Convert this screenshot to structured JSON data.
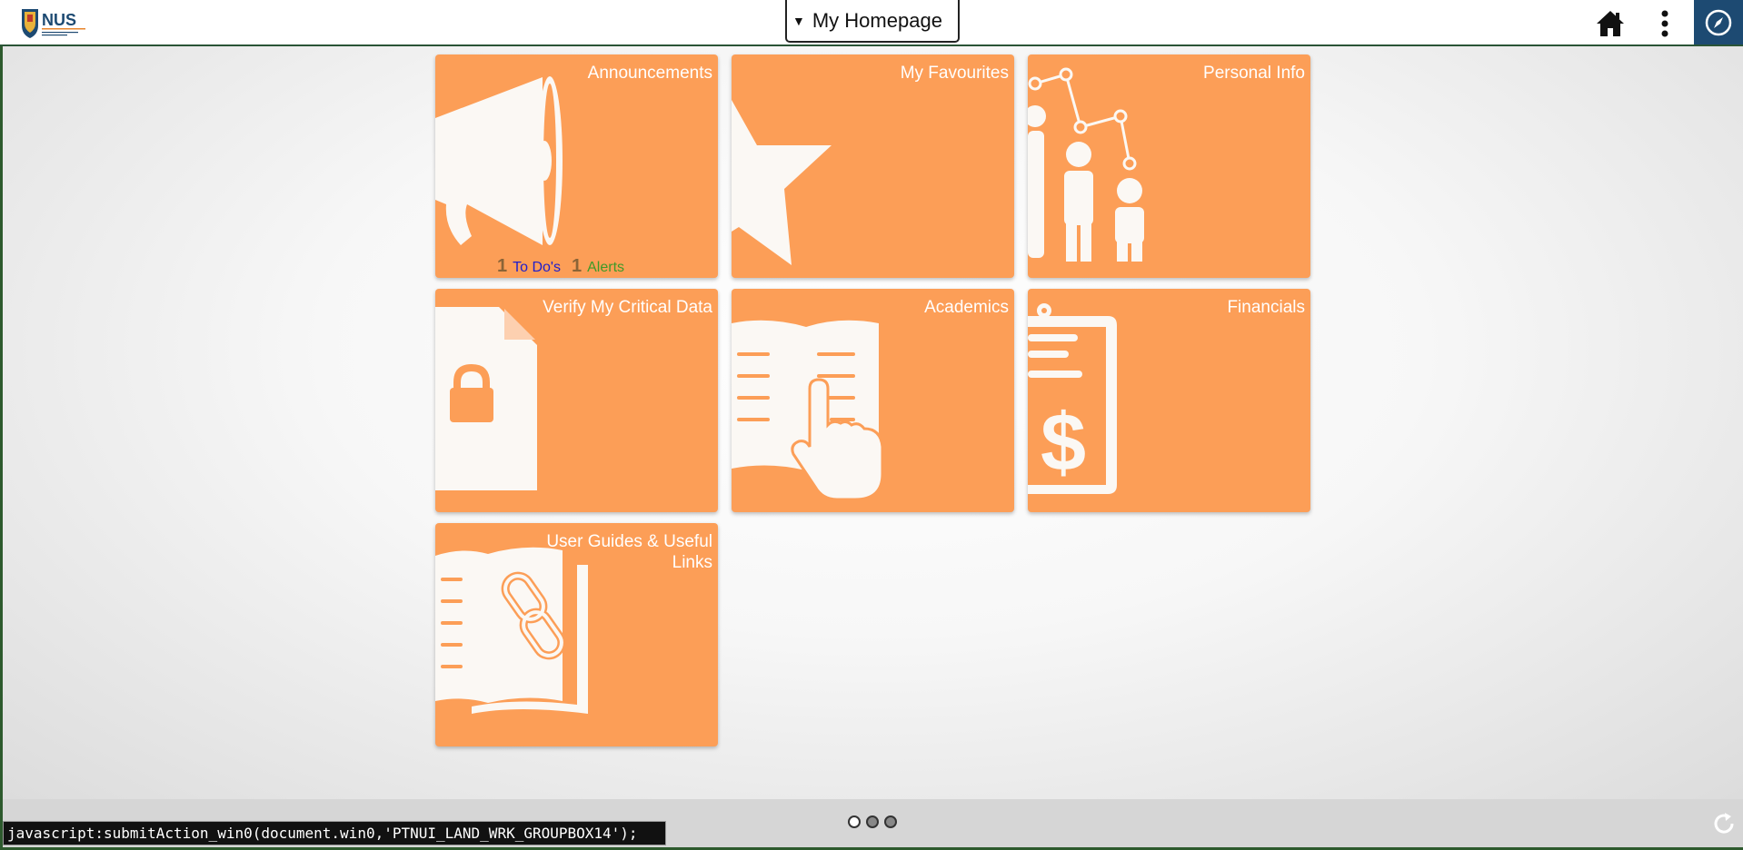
{
  "header": {
    "logo_text": "NUS",
    "logo_subtext": "National University of Singapore",
    "homepage_selector": "My Homepage",
    "home_icon": "home-icon",
    "menu_icon": "kebab-menu-icon",
    "navbar_icon": "compass-icon"
  },
  "tiles": [
    {
      "title": "Announcements",
      "icon": "megaphone-icon"
    },
    {
      "title": "My Favourites",
      "icon": "star-icon"
    },
    {
      "title": "Personal Info",
      "icon": "people-chart-icon"
    },
    {
      "title": "Verify My Critical Data",
      "icon": "locked-document-icon"
    },
    {
      "title": "Academics",
      "icon": "book-pointer-icon"
    },
    {
      "title": "Financials",
      "icon": "clipboard-dollar-icon"
    },
    {
      "title": "User Guides & Useful Links",
      "icon": "book-link-icon"
    }
  ],
  "announcements_counts": {
    "todo_count": "1",
    "todo_label": "To Do's",
    "alerts_count": "1",
    "alerts_label": "Alerts"
  },
  "footer": {
    "pages": 3,
    "active_page": 1,
    "status_text": "javascript:submitAction_win0(document.win0,'PTNUI_LAND_WRK_GROUPBOX14');"
  },
  "colors": {
    "tile": "#fc9e57",
    "nav_button": "#1d4a72",
    "todo": "#1e1ecc",
    "alerts": "#3e9a28"
  }
}
